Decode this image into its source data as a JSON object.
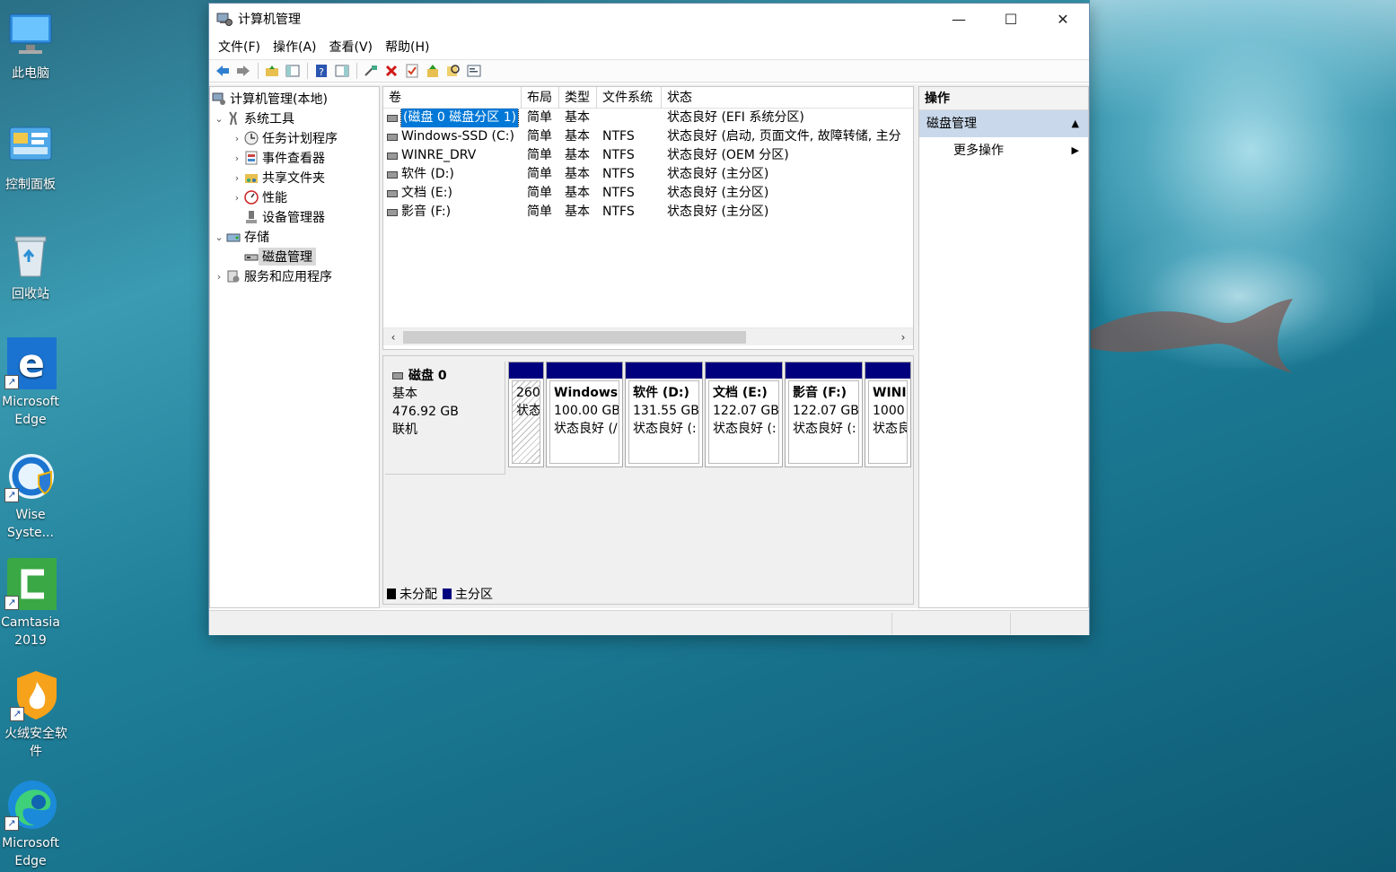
{
  "desktop": {
    "icons": [
      {
        "label": "此电脑",
        "icon": "computer-icon"
      },
      {
        "label": "控制面板",
        "icon": "control-panel-icon"
      },
      {
        "label": "回收站",
        "icon": "recycle-bin-icon"
      },
      {
        "label": "Microsoft\nEdge",
        "icon": "edge-legacy-icon"
      },
      {
        "label": "Wise\nSyste...",
        "icon": "wise-system-icon"
      },
      {
        "label": "Camtasia\n2019",
        "icon": "camtasia-icon"
      },
      {
        "label": "火绒安全软件",
        "icon": "huorong-icon"
      },
      {
        "label": "Microsoft\nEdge",
        "icon": "edge-icon"
      }
    ]
  },
  "window": {
    "title": "计算机管理",
    "controls": {
      "minimize": "—",
      "maximize": "☐",
      "close": "✕"
    },
    "menu": [
      "文件(F)",
      "操作(A)",
      "查看(V)",
      "帮助(H)"
    ]
  },
  "tree": {
    "root": "计算机管理(本地)",
    "system_tools": "系统工具",
    "task_scheduler": "任务计划程序",
    "event_viewer": "事件查看器",
    "shared_folders": "共享文件夹",
    "performance": "性能",
    "device_manager": "设备管理器",
    "storage": "存储",
    "disk_management": "磁盘管理",
    "services_apps": "服务和应用程序"
  },
  "volumes": {
    "headers": {
      "volume": "卷",
      "layout": "布局",
      "type": "类型",
      "fs": "文件系统",
      "status": "状态"
    },
    "rows": [
      {
        "name": "(磁盘 0 磁盘分区 1)",
        "layout": "简单",
        "type": "基本",
        "fs": "",
        "status": "状态良好 (EFI 系统分区)"
      },
      {
        "name": "Windows-SSD (C:)",
        "layout": "简单",
        "type": "基本",
        "fs": "NTFS",
        "status": "状态良好 (启动, 页面文件, 故障转储, 主分"
      },
      {
        "name": "WINRE_DRV",
        "layout": "简单",
        "type": "基本",
        "fs": "NTFS",
        "status": "状态良好 (OEM 分区)"
      },
      {
        "name": "软件 (D:)",
        "layout": "简单",
        "type": "基本",
        "fs": "NTFS",
        "status": "状态良好 (主分区)"
      },
      {
        "name": "文档 (E:)",
        "layout": "简单",
        "type": "基本",
        "fs": "NTFS",
        "status": "状态良好 (主分区)"
      },
      {
        "name": "影音 (F:)",
        "layout": "简单",
        "type": "基本",
        "fs": "NTFS",
        "status": "状态良好 (主分区)"
      }
    ]
  },
  "disk": {
    "name": "磁盘 0",
    "kind": "基本",
    "size": "476.92 GB",
    "state": "联机",
    "partitions": [
      {
        "name": "",
        "size": "260",
        "status": "状态"
      },
      {
        "name": "Windows",
        "size": "100.00 GB",
        "status": "状态良好 (/"
      },
      {
        "name": "软件  (D:)",
        "size": "131.55 GB",
        "status": "状态良好 (:"
      },
      {
        "name": "文档  (E:)",
        "size": "122.07 GB",
        "status": "状态良好 (:"
      },
      {
        "name": "影音  (F:)",
        "size": "122.07 GB",
        "status": "状态良好 (:"
      },
      {
        "name": "WINI",
        "size": "1000",
        "status": "状态良"
      }
    ]
  },
  "legend": {
    "unallocated": "未分配",
    "primary": "主分区"
  },
  "colors": {
    "primary_partition": "#00007f",
    "unallocated": "#000000",
    "selection": "#0078d7",
    "actions_section": "#c9d8ea"
  },
  "actions": {
    "header": "操作",
    "section": "磁盘管理",
    "more": "更多操作"
  }
}
